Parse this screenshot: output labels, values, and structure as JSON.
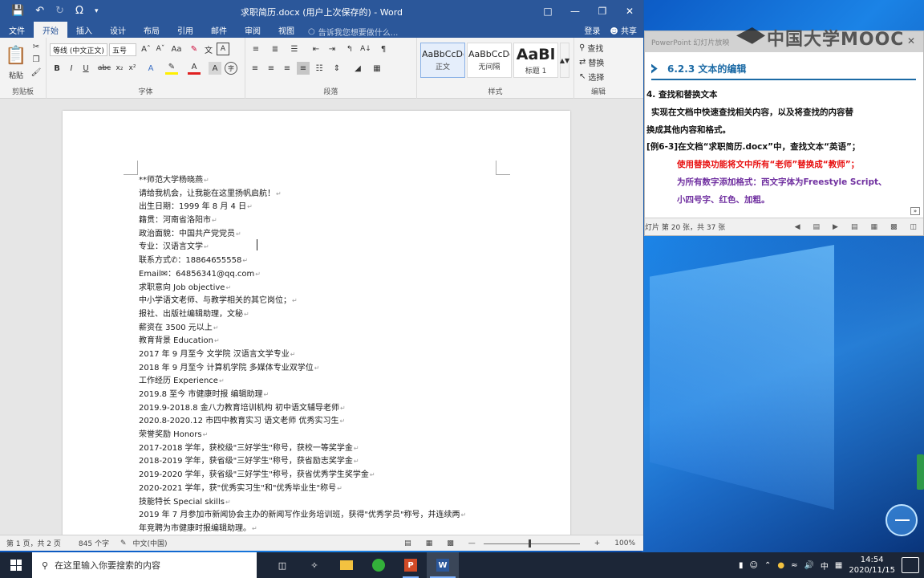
{
  "word": {
    "title": "求职简历.docx (用户上次保存的) - Word",
    "tabs": [
      "文件",
      "开始",
      "插入",
      "设计",
      "布局",
      "引用",
      "邮件",
      "审阅",
      "视图"
    ],
    "tell_me": "告诉我您想要做什么...",
    "login": "登录",
    "share": "共享",
    "ribbon": {
      "paste": "粘贴",
      "font_name": "等线 (中文正文)",
      "font_size": "五号",
      "groups": {
        "clipboard": "剪贴板",
        "font": "字体",
        "paragraph": "段落",
        "styles": "样式",
        "editing": "编辑"
      },
      "styles": [
        {
          "preview": "AaBbCcDc",
          "name": "正文"
        },
        {
          "preview": "AaBbCcDc",
          "name": "无间隔"
        },
        {
          "preview": "AaBl",
          "name": "标题 1"
        }
      ],
      "find": "查找",
      "replace": "替换",
      "select": "选择"
    },
    "document_lines": [
      "**师范大学杨晓燕",
      "请给我机会，让我能在这里扬帆启航！",
      "出生日期：1999 年 8 月 4 日",
      "籍贯：河南省洛阳市",
      "政治面貌：中国共产党党员",
      "专业：汉语言文学",
      "联系方式✆：18864655558",
      "Email✉：64856341@qq.com",
      "求职意向  Job objective",
      "中小学语文老师、与教学相关的其它岗位；",
      "报社、出版社编辑助理，文秘",
      "薪资在 3500 元以上",
      "教育背景  Education",
      "2017 年 9 月至今  文学院  汉语言文学专业",
      "2018 年 9 月至今  计算机学院  多媒体专业双学位",
      "工作经历  Experience",
      "2019.8 至今  市健康时报  编辑助理",
      "2019.9-2018.8  金八力教育培训机构  初中语文辅导老师",
      "2020.8-2020.12  市四中教育实习  语文老师  优秀实习生",
      "荣誉奖励  Honors",
      "2017-2018 学年，获校级\"三好学生\"称号，获校一等奖学金",
      "2018-2019 学年，获省级\"三好学生\"称号，获省励志奖学金",
      "2019-2020 学年，获省级\"三好学生\"称号，获省优秀学生奖学金",
      "2020-2021 学年，获\"优秀实习生\"和\"优秀毕业生\"称号",
      "技能特长  Special skills",
      "2019 年 7 月参加市新闻协会主办的新闻写作业务培训班，获得\"优秀学员\"称号，并连续两",
      "年竞聘为市健康时报编辑助理。"
    ],
    "status": {
      "page": "第 1 页，共 2 页",
      "words": "845 个字",
      "language": "中文(中国)",
      "zoom": "100%",
      "zoom_level": 1.0
    }
  },
  "ppt": {
    "header_title": "PowerPoint 幻灯片放映",
    "logo": "中国大学MOOC",
    "slide": {
      "heading": "6.2.3  文本的编辑",
      "lines": [
        {
          "text": "4.  查找和替换文本",
          "color": "black"
        },
        {
          "text": "    实现在文档中快速查找相关内容，以及将查找的内容替",
          "color": "black"
        },
        {
          "text": "换成其他内容和格式。",
          "color": "black"
        },
        {
          "text": "[例6-3]在文档“求职简历.docx”中，查找文本“英语”；",
          "color": "black"
        },
        {
          "text": "使用替换功能将文中所有“老师”替换成“教师”；",
          "color": "red"
        },
        {
          "text": "为所有数字添加格式：西文字体为Freestyle Script、",
          "color": "purple"
        },
        {
          "text": "小四号字、红色、加粗。",
          "color": "purple"
        }
      ]
    },
    "status": "灯片 第 20 张，共 37 张"
  },
  "taskbar": {
    "search_placeholder": "在这里输入你要搜索的内容",
    "ime": "中",
    "time": "14:54",
    "date": "2020/11/15"
  },
  "colors": {
    "word_blue": "#2b579a",
    "slide_blue": "#1b6aa5",
    "red": "#e81010",
    "purple": "#7030a0"
  }
}
